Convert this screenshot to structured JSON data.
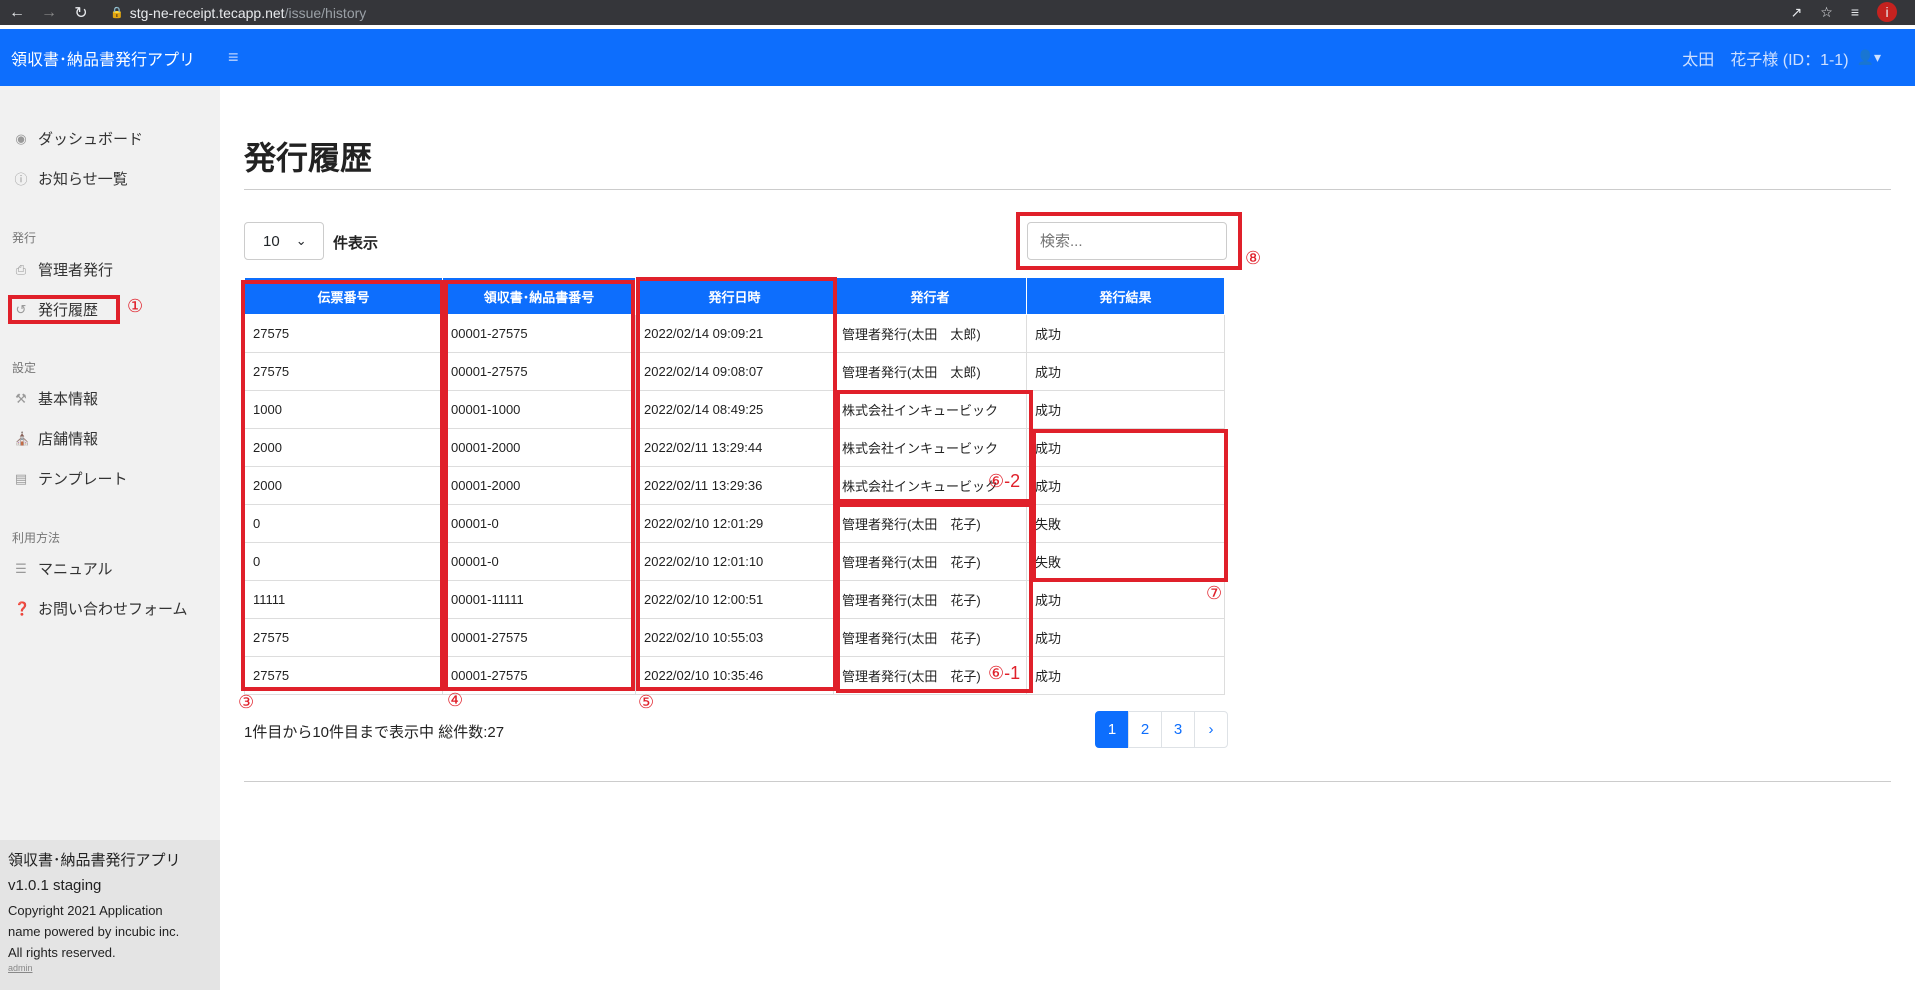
{
  "browser": {
    "url_host": "stg-ne-receipt.tecapp.net",
    "url_path": "/issue/history",
    "profile_initial": "i"
  },
  "header": {
    "brand": "領収書･納品書発行アプリ",
    "user_label": "太田　花子様 (ID：1-1)"
  },
  "sidebar": {
    "dashboard": "ダッシュボード",
    "notices": "お知らせ一覧",
    "section_issue": "発行",
    "admin_issue": "管理者発行",
    "history": "発行履歴",
    "section_settings": "設定",
    "basic_info": "基本情報",
    "store_info": "店舗情報",
    "template": "テンプレート",
    "section_usage": "利用方法",
    "manual": "マニュアル",
    "contact": "お問い合わせフォーム",
    "footer_app": "領収書･納品書発行アプリ",
    "footer_version": "v1.0.1 staging",
    "footer_copyright_1": "Copyright 2021 Application",
    "footer_copyright_2": "name powered by incubic inc.",
    "footer_copyright_3": "All rights reserved.",
    "footer_admin": "admin"
  },
  "main": {
    "title": "発行履歴",
    "page_length": "10",
    "page_length_label": "件表示",
    "search_placeholder": "検索...",
    "columns": [
      "伝票番号",
      "領収書･納品書番号",
      "発行日時",
      "発行者",
      "発行結果"
    ],
    "rows": [
      [
        "27575",
        "00001-27575",
        "2022/02/14 09:09:21",
        "管理者発行(太田　太郎)",
        "成功"
      ],
      [
        "27575",
        "00001-27575",
        "2022/02/14 09:08:07",
        "管理者発行(太田　太郎)",
        "成功"
      ],
      [
        "1000",
        "00001-1000",
        "2022/02/14 08:49:25",
        "株式会社インキュービック",
        "成功"
      ],
      [
        "2000",
        "00001-2000",
        "2022/02/11 13:29:44",
        "株式会社インキュービック",
        "成功"
      ],
      [
        "2000",
        "00001-2000",
        "2022/02/11 13:29:36",
        "株式会社インキュービック",
        "成功"
      ],
      [
        "0",
        "00001-0",
        "2022/02/10 12:01:29",
        "管理者発行(太田　花子)",
        "失敗"
      ],
      [
        "0",
        "00001-0",
        "2022/02/10 12:01:10",
        "管理者発行(太田　花子)",
        "失敗"
      ],
      [
        "11111",
        "00001-11111",
        "2022/02/10 12:00:51",
        "管理者発行(太田　花子)",
        "成功"
      ],
      [
        "27575",
        "00001-27575",
        "2022/02/10 10:55:03",
        "管理者発行(太田　花子)",
        "成功"
      ],
      [
        "27575",
        "00001-27575",
        "2022/02/10 10:35:46",
        "管理者発行(太田　花子)",
        "成功"
      ]
    ],
    "info": "1件目から10件目まで表示中 総件数:27",
    "pages": [
      "1",
      "2",
      "3",
      "›"
    ]
  },
  "annotations": {
    "a1": "①",
    "a3": "③",
    "a4": "④",
    "a5": "⑤",
    "a6_1": "⑥-1",
    "a6_2": "⑥-2",
    "a7": "⑦",
    "a8": "⑧"
  },
  "colors": {
    "primary": "#0d6efd",
    "annotation": "#e0202a"
  }
}
